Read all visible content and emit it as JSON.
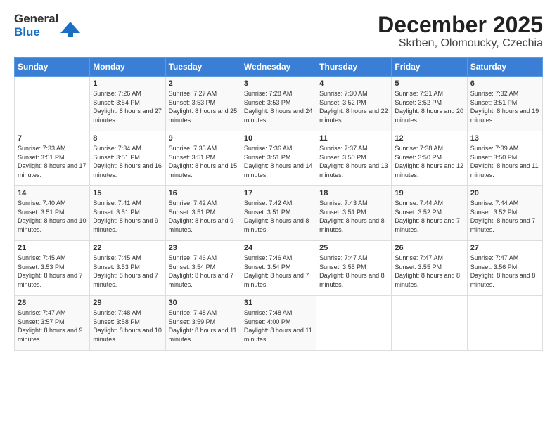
{
  "header": {
    "logo_general": "General",
    "logo_blue": "Blue",
    "month": "December 2025",
    "location": "Skrben, Olomoucky, Czechia"
  },
  "days_of_week": [
    "Sunday",
    "Monday",
    "Tuesday",
    "Wednesday",
    "Thursday",
    "Friday",
    "Saturday"
  ],
  "weeks": [
    [
      {
        "day": "",
        "sunrise": "",
        "sunset": "",
        "daylight": ""
      },
      {
        "day": "1",
        "sunrise": "7:26 AM",
        "sunset": "3:54 PM",
        "daylight": "8 hours and 27 minutes."
      },
      {
        "day": "2",
        "sunrise": "7:27 AM",
        "sunset": "3:53 PM",
        "daylight": "8 hours and 25 minutes."
      },
      {
        "day": "3",
        "sunrise": "7:28 AM",
        "sunset": "3:53 PM",
        "daylight": "8 hours and 24 minutes."
      },
      {
        "day": "4",
        "sunrise": "7:30 AM",
        "sunset": "3:52 PM",
        "daylight": "8 hours and 22 minutes."
      },
      {
        "day": "5",
        "sunrise": "7:31 AM",
        "sunset": "3:52 PM",
        "daylight": "8 hours and 20 minutes."
      },
      {
        "day": "6",
        "sunrise": "7:32 AM",
        "sunset": "3:51 PM",
        "daylight": "8 hours and 19 minutes."
      }
    ],
    [
      {
        "day": "7",
        "sunrise": "7:33 AM",
        "sunset": "3:51 PM",
        "daylight": "8 hours and 17 minutes."
      },
      {
        "day": "8",
        "sunrise": "7:34 AM",
        "sunset": "3:51 PM",
        "daylight": "8 hours and 16 minutes."
      },
      {
        "day": "9",
        "sunrise": "7:35 AM",
        "sunset": "3:51 PM",
        "daylight": "8 hours and 15 minutes."
      },
      {
        "day": "10",
        "sunrise": "7:36 AM",
        "sunset": "3:51 PM",
        "daylight": "8 hours and 14 minutes."
      },
      {
        "day": "11",
        "sunrise": "7:37 AM",
        "sunset": "3:50 PM",
        "daylight": "8 hours and 13 minutes."
      },
      {
        "day": "12",
        "sunrise": "7:38 AM",
        "sunset": "3:50 PM",
        "daylight": "8 hours and 12 minutes."
      },
      {
        "day": "13",
        "sunrise": "7:39 AM",
        "sunset": "3:50 PM",
        "daylight": "8 hours and 11 minutes."
      }
    ],
    [
      {
        "day": "14",
        "sunrise": "7:40 AM",
        "sunset": "3:51 PM",
        "daylight": "8 hours and 10 minutes."
      },
      {
        "day": "15",
        "sunrise": "7:41 AM",
        "sunset": "3:51 PM",
        "daylight": "8 hours and 9 minutes."
      },
      {
        "day": "16",
        "sunrise": "7:42 AM",
        "sunset": "3:51 PM",
        "daylight": "8 hours and 9 minutes."
      },
      {
        "day": "17",
        "sunrise": "7:42 AM",
        "sunset": "3:51 PM",
        "daylight": "8 hours and 8 minutes."
      },
      {
        "day": "18",
        "sunrise": "7:43 AM",
        "sunset": "3:51 PM",
        "daylight": "8 hours and 8 minutes."
      },
      {
        "day": "19",
        "sunrise": "7:44 AM",
        "sunset": "3:52 PM",
        "daylight": "8 hours and 7 minutes."
      },
      {
        "day": "20",
        "sunrise": "7:44 AM",
        "sunset": "3:52 PM",
        "daylight": "8 hours and 7 minutes."
      }
    ],
    [
      {
        "day": "21",
        "sunrise": "7:45 AM",
        "sunset": "3:53 PM",
        "daylight": "8 hours and 7 minutes."
      },
      {
        "day": "22",
        "sunrise": "7:45 AM",
        "sunset": "3:53 PM",
        "daylight": "8 hours and 7 minutes."
      },
      {
        "day": "23",
        "sunrise": "7:46 AM",
        "sunset": "3:54 PM",
        "daylight": "8 hours and 7 minutes."
      },
      {
        "day": "24",
        "sunrise": "7:46 AM",
        "sunset": "3:54 PM",
        "daylight": "8 hours and 7 minutes."
      },
      {
        "day": "25",
        "sunrise": "7:47 AM",
        "sunset": "3:55 PM",
        "daylight": "8 hours and 8 minutes."
      },
      {
        "day": "26",
        "sunrise": "7:47 AM",
        "sunset": "3:55 PM",
        "daylight": "8 hours and 8 minutes."
      },
      {
        "day": "27",
        "sunrise": "7:47 AM",
        "sunset": "3:56 PM",
        "daylight": "8 hours and 8 minutes."
      }
    ],
    [
      {
        "day": "28",
        "sunrise": "7:47 AM",
        "sunset": "3:57 PM",
        "daylight": "8 hours and 9 minutes."
      },
      {
        "day": "29",
        "sunrise": "7:48 AM",
        "sunset": "3:58 PM",
        "daylight": "8 hours and 10 minutes."
      },
      {
        "day": "30",
        "sunrise": "7:48 AM",
        "sunset": "3:59 PM",
        "daylight": "8 hours and 11 minutes."
      },
      {
        "day": "31",
        "sunrise": "7:48 AM",
        "sunset": "4:00 PM",
        "daylight": "8 hours and 11 minutes."
      },
      {
        "day": "",
        "sunrise": "",
        "sunset": "",
        "daylight": ""
      },
      {
        "day": "",
        "sunrise": "",
        "sunset": "",
        "daylight": ""
      },
      {
        "day": "",
        "sunrise": "",
        "sunset": "",
        "daylight": ""
      }
    ]
  ],
  "labels": {
    "sunrise": "Sunrise:",
    "sunset": "Sunset:",
    "daylight": "Daylight:"
  }
}
